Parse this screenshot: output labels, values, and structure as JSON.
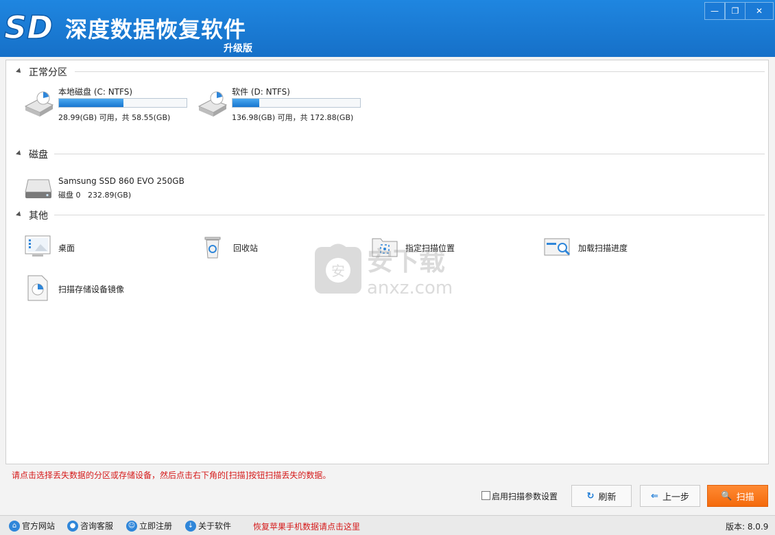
{
  "titlebar": {
    "logo_text": "SD",
    "title": "深度数据恢复软件",
    "edition": "升级版",
    "minimize_label": "—",
    "restore_label": "❐",
    "close_label": "✕"
  },
  "sections": {
    "partitions_title": "正常分区",
    "disks_title": "磁盘",
    "other_title": "其他"
  },
  "partitions": [
    {
      "name": "本地磁盘 (C: NTFS)",
      "size_text": "28.99(GB) 可用，共 58.55(GB)",
      "used_fraction": 0.505
    },
    {
      "name": "软件 (D: NTFS)",
      "size_text": "136.98(GB) 可用，共 172.88(GB)",
      "used_fraction": 0.208
    }
  ],
  "disks": [
    {
      "name": "Samsung SSD 860 EVO 250GB",
      "id": "磁盘 0",
      "size": "232.89(GB)"
    }
  ],
  "other": [
    {
      "label": "桌面",
      "icon": "desktop-icon"
    },
    {
      "label": "回收站",
      "icon": "recycle-bin-icon"
    },
    {
      "label": "指定扫描位置",
      "icon": "folder-scan-icon"
    },
    {
      "label": "加载扫描进度",
      "icon": "load-progress-icon"
    },
    {
      "label": "扫描存储设备镜像",
      "icon": "disk-image-icon"
    }
  ],
  "watermark": {
    "logo_text": "安",
    "title": "安下载",
    "domain": "anxz.com"
  },
  "hint": "请点击选择丢失数据的分区或存储设备，然后点击右下角的[扫描]按钮扫描丢失的数据。",
  "controls": {
    "scan_params_label": "启用扫描参数设置",
    "refresh_label": "刷新",
    "back_label": "上一步",
    "scan_label": "扫描",
    "refresh_icon": "↻",
    "back_icon": "⇐",
    "scan_icon": "🔍"
  },
  "statusbar": {
    "website": "官方网站",
    "consult": "咨询客服",
    "register": "立即注册",
    "about": "关于软件",
    "iphone_link": "恢复苹果手机数据请点击这里",
    "version": "版本: 8.0.9"
  },
  "colors": {
    "accent": "#1b7ad6",
    "scan_button": "#f46a0c",
    "hint": "#d51a1a"
  }
}
